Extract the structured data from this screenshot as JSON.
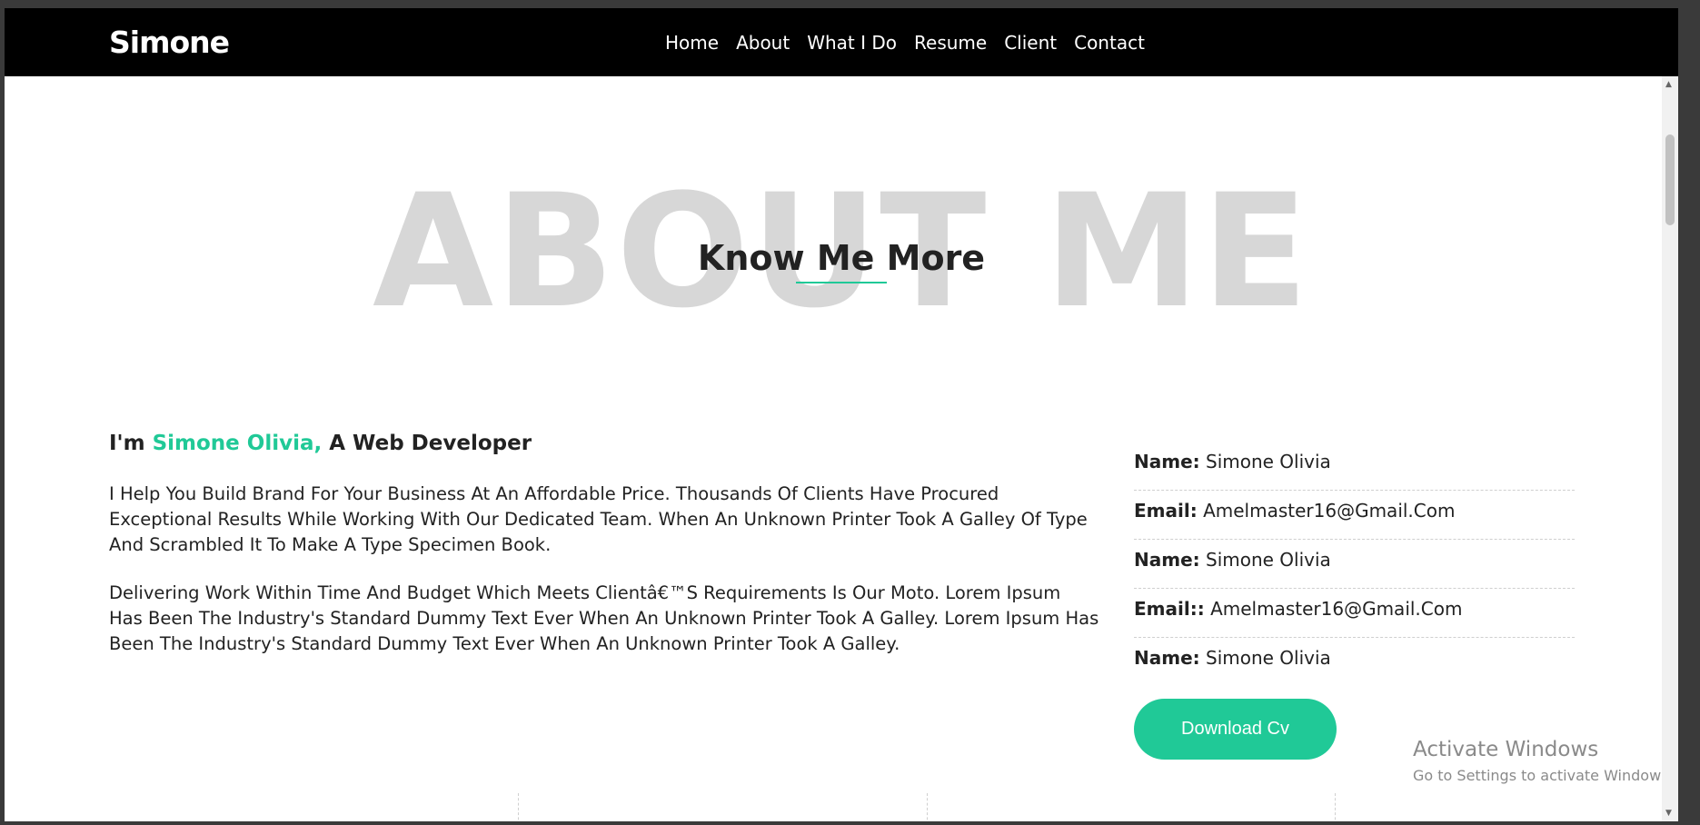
{
  "navbar": {
    "brand": "Simone",
    "links": [
      "Home",
      "About",
      "What I Do",
      "Resume",
      "Client",
      "Contact"
    ]
  },
  "about": {
    "bg_title": "ABOUT ME",
    "title": "Know Me More",
    "intro_prefix": "I'm ",
    "intro_name": "Simone Olivia,",
    "intro_suffix": " A Web Developer",
    "paragraph1": "I Help You Build Brand For Your Business At An Affordable Price. Thousands Of Clients Have Procured Exceptional Results While Working With Our Dedicated Team. When An Unknown Printer Took A Galley Of Type And Scrambled It To Make A Type Specimen Book.",
    "paragraph2": "Delivering Work Within Time And Budget Which Meets Clientâ€™S Requirements Is Our Moto. Lorem Ipsum Has Been The Industry's Standard Dummy Text Ever When An Unknown Printer Took A Galley. Lorem Ipsum Has Been The Industry's Standard Dummy Text Ever When An Unknown Printer Took A Galley.",
    "info": [
      {
        "label": "Name:",
        "value": "Simone Olivia"
      },
      {
        "label": "Email:",
        "value": "Amelmaster16@Gmail.Com"
      },
      {
        "label": "Name:",
        "value": "Simone Olivia"
      },
      {
        "label": "Email::",
        "value": "Amelmaster16@Gmail.Com"
      },
      {
        "label": "Name:",
        "value": "Simone Olivia"
      }
    ],
    "download_label": "Download Cv"
  },
  "watermark": {
    "line1": "Activate Windows",
    "line2": "Go to Settings to activate Windows."
  },
  "colors": {
    "accent": "#20c997",
    "navbar_bg": "#000000",
    "bg_title": "#d7d7d7"
  }
}
